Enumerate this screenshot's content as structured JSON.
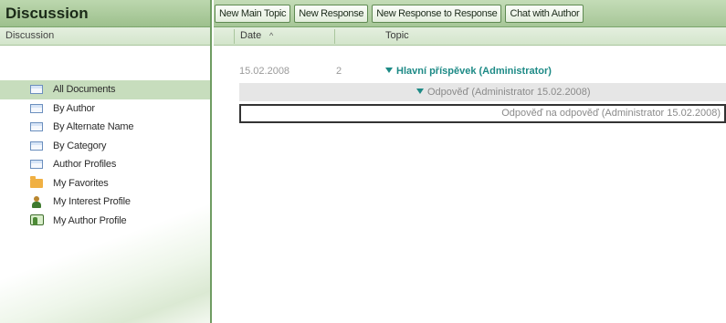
{
  "sidebar": {
    "title": "Discussion",
    "subheader": "Discussion",
    "items": [
      {
        "label": "All Documents",
        "icon": "document-view-icon"
      },
      {
        "label": "By Author",
        "icon": "document-view-icon"
      },
      {
        "label": "By Alternate Name",
        "icon": "document-view-icon"
      },
      {
        "label": "By Category",
        "icon": "document-view-icon"
      },
      {
        "label": "Author Profiles",
        "icon": "document-view-icon"
      },
      {
        "label": "My Favorites",
        "icon": "folder-icon"
      },
      {
        "label": "My Interest Profile",
        "icon": "person-icon"
      },
      {
        "label": "My Author Profile",
        "icon": "profile-icon"
      }
    ],
    "selected": "All Documents"
  },
  "toolbar": {
    "new_main_topic": "New Main Topic",
    "new_response": "New Response",
    "new_response_to_response": "New Response to Response",
    "chat_with_author": "Chat with Author"
  },
  "columns": {
    "date": "Date",
    "sort_indicator": "^",
    "topic": "Topic"
  },
  "rows": [
    {
      "date": "15.02.2008",
      "count": "2",
      "topic": "Hlavní příspěvek (Administrator)"
    },
    {
      "topic": "Odpověď  (Administrator 15.02.2008)"
    },
    {
      "topic": "Odpověď na odpověď  (Administrator 15.02.2008)"
    }
  ],
  "colors": {
    "accent_green": "#9dc08d",
    "topic_teal": "#1d8a86",
    "selected_row": "#c7ddbd"
  }
}
